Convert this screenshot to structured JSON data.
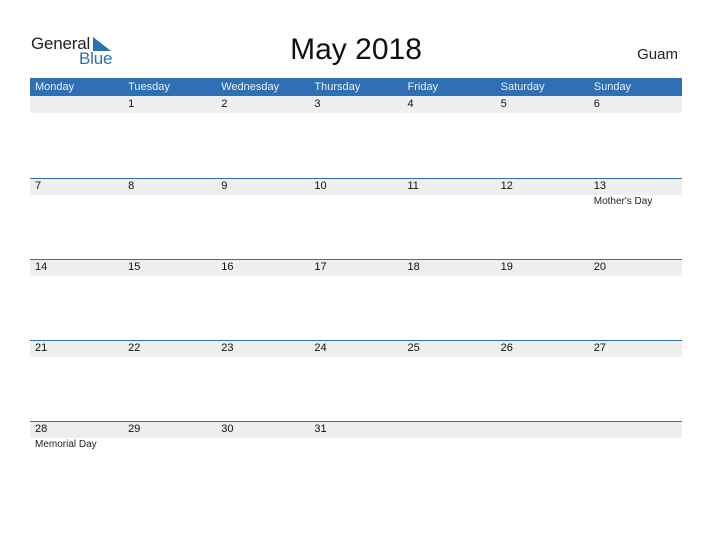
{
  "logo": {
    "word1": "General",
    "word2": "Blue",
    "brand_color": "#2a72b8"
  },
  "title": "May 2018",
  "country": "Guam",
  "header_color": "#2f6fb3",
  "weekdays": [
    "Monday",
    "Tuesday",
    "Wednesday",
    "Thursday",
    "Friday",
    "Saturday",
    "Sunday"
  ],
  "weeks": [
    {
      "days": [
        {
          "n": "",
          "e": ""
        },
        {
          "n": "1",
          "e": ""
        },
        {
          "n": "2",
          "e": ""
        },
        {
          "n": "3",
          "e": ""
        },
        {
          "n": "4",
          "e": ""
        },
        {
          "n": "5",
          "e": ""
        },
        {
          "n": "6",
          "e": ""
        }
      ]
    },
    {
      "days": [
        {
          "n": "7",
          "e": ""
        },
        {
          "n": "8",
          "e": ""
        },
        {
          "n": "9",
          "e": ""
        },
        {
          "n": "10",
          "e": ""
        },
        {
          "n": "11",
          "e": ""
        },
        {
          "n": "12",
          "e": ""
        },
        {
          "n": "13",
          "e": "Mother's Day"
        }
      ]
    },
    {
      "days": [
        {
          "n": "14",
          "e": ""
        },
        {
          "n": "15",
          "e": ""
        },
        {
          "n": "16",
          "e": ""
        },
        {
          "n": "17",
          "e": ""
        },
        {
          "n": "18",
          "e": ""
        },
        {
          "n": "19",
          "e": ""
        },
        {
          "n": "20",
          "e": ""
        }
      ]
    },
    {
      "days": [
        {
          "n": "21",
          "e": ""
        },
        {
          "n": "22",
          "e": ""
        },
        {
          "n": "23",
          "e": ""
        },
        {
          "n": "24",
          "e": ""
        },
        {
          "n": "25",
          "e": ""
        },
        {
          "n": "26",
          "e": ""
        },
        {
          "n": "27",
          "e": ""
        }
      ]
    },
    {
      "days": [
        {
          "n": "28",
          "e": "Memorial Day"
        },
        {
          "n": "29",
          "e": ""
        },
        {
          "n": "30",
          "e": ""
        },
        {
          "n": "31",
          "e": ""
        },
        {
          "n": "",
          "e": ""
        },
        {
          "n": "",
          "e": ""
        },
        {
          "n": "",
          "e": ""
        }
      ]
    }
  ]
}
